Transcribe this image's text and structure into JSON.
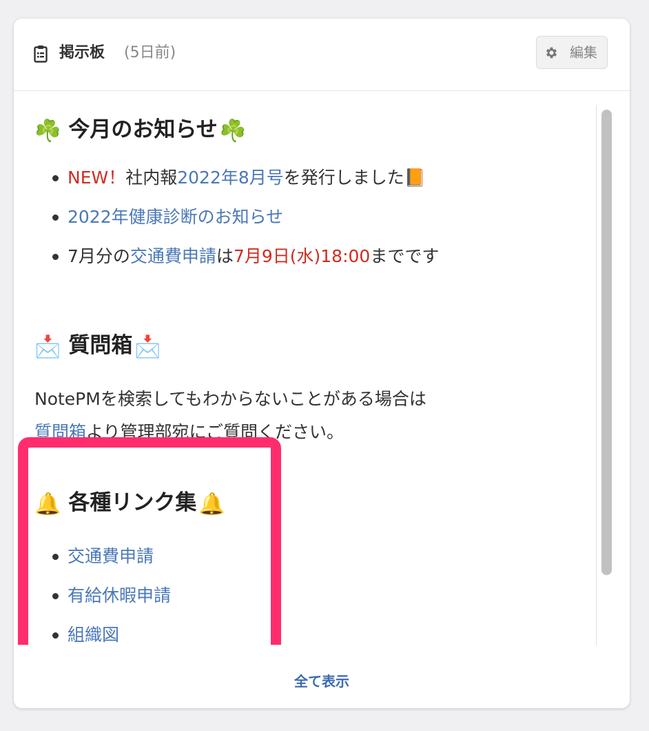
{
  "header": {
    "title": "掲示板",
    "age": "(5日前)",
    "edit_label": "編集"
  },
  "sections": {
    "notice": {
      "heading_emoji": "☘️",
      "heading_text": "今月のお知らせ",
      "item1": {
        "new": "NEW！",
        "text1": "社内報",
        "link": "2022年8月号",
        "text2": "を発行しました",
        "emoji": "📙"
      },
      "item2": {
        "link": "2022年健康診断のお知らせ"
      },
      "item3": {
        "text1": "7月分の",
        "link": "交通費申請",
        "text2": "は",
        "deadline": "7月9日(水)18:00",
        "text3": "までです"
      }
    },
    "question": {
      "heading_emoji": "📩",
      "heading_text": "質問箱",
      "line1": "NotePMを検索してもわからないことがある場合は",
      "line2_link": "質問箱",
      "line2_text": "より管理部宛にご質問ください。"
    },
    "links": {
      "heading_emoji": "🔔",
      "heading_text": "各種リンク集",
      "items": [
        "交通費申請",
        "有給休暇申請",
        "組織図"
      ]
    }
  },
  "footer": {
    "show_all": "全て表示"
  },
  "colors": {
    "link": "#4a78b8",
    "red": "#d22b1f",
    "highlight": "#ff2d6e"
  }
}
